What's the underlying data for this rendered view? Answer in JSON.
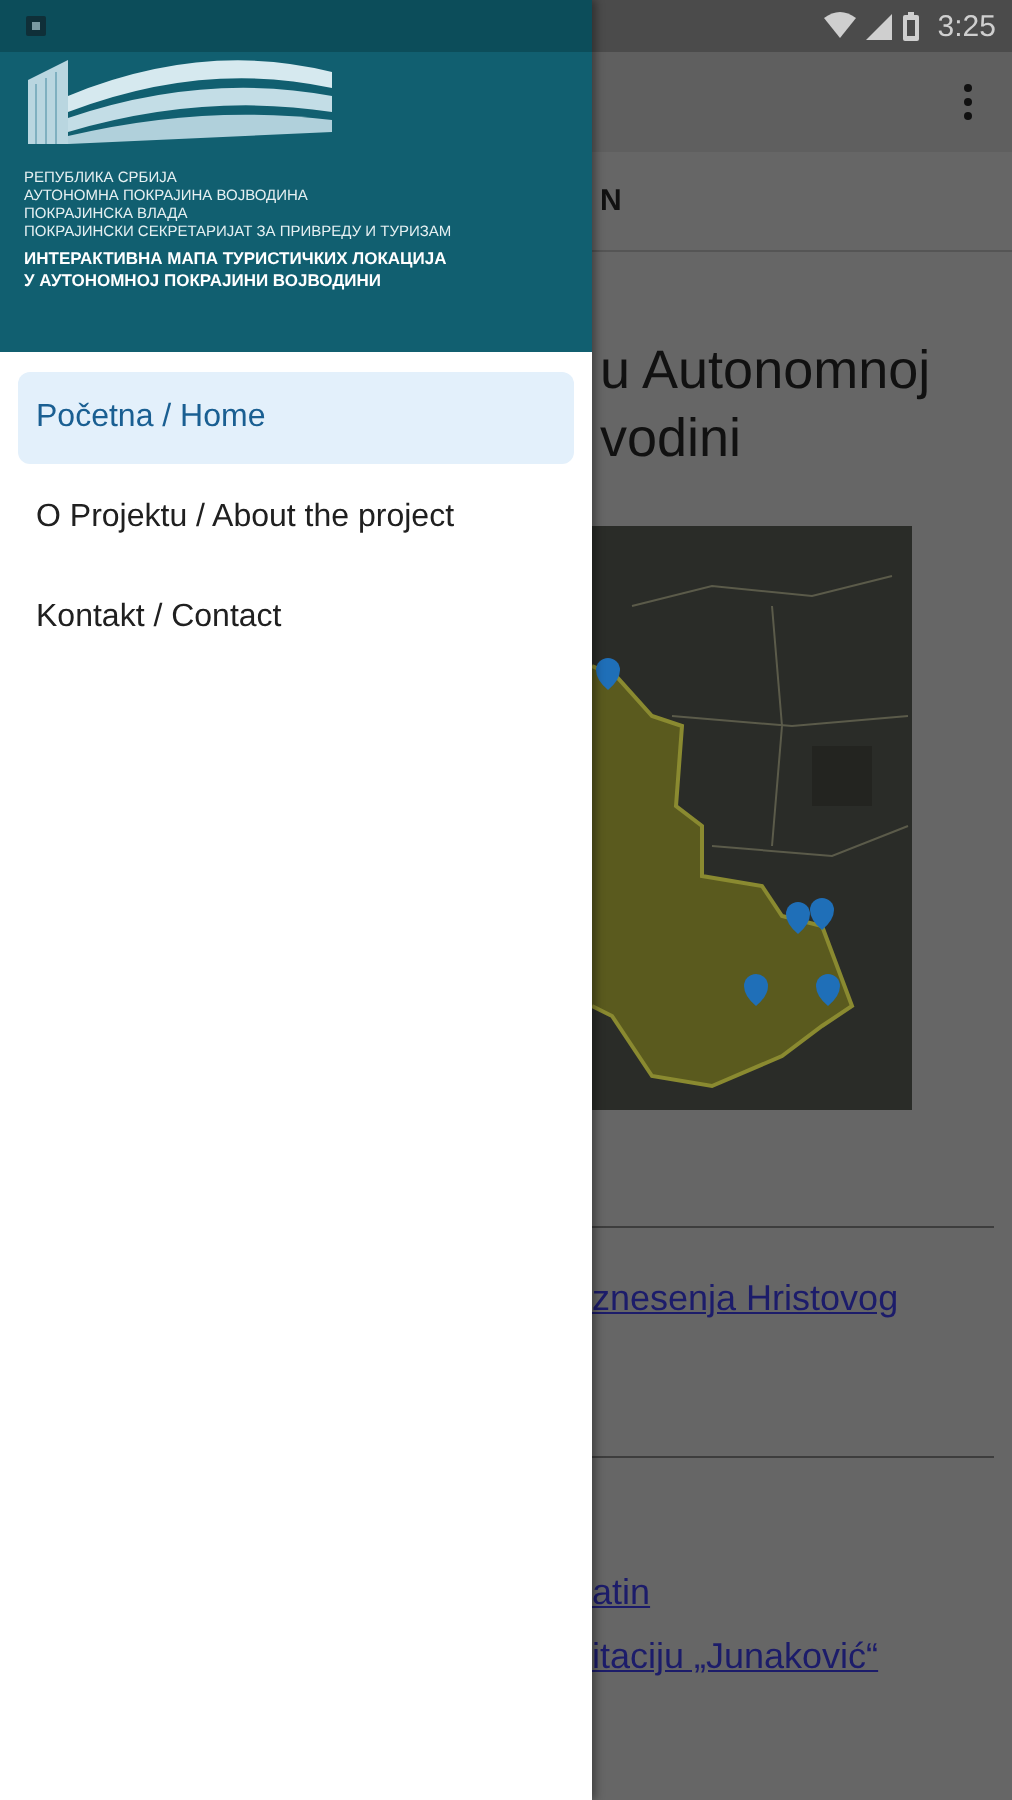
{
  "status_bar": {
    "time": "3:25"
  },
  "drawer": {
    "header": {
      "subtitle_lines": [
        "РЕПУБЛИКА СРБИЈА",
        "АУТОНОМНА ПОКРАЈИНА ВОЈВОДИНА",
        "ПОКРАЈИНСКА ВЛАДА",
        "ПОКРАЈИНСКИ СЕКРЕТАРИЈАТ ЗА ПРИВРЕДУ И ТУРИЗАМ"
      ],
      "title_lines": [
        "ИНТЕРАКТИВНА МАПА ТУРИСТИЧКИХ ЛОКАЦИЈА",
        "У АУТОНОМНОЈ ПОКРАЈИНИ ВОЈВОДИНИ"
      ]
    },
    "items": [
      {
        "label": "Početna / Home",
        "selected": true
      },
      {
        "label": "O Projektu / About the project",
        "selected": false
      },
      {
        "label": "Kontakt / Contact",
        "selected": false
      }
    ]
  },
  "background_page": {
    "tab_label": "N",
    "heading_lines": [
      "u Autonomnoj",
      "vodini"
    ],
    "map": {
      "kind": "picture"
    },
    "sections": [
      {
        "links": [
          "znesenja Hristovog"
        ]
      },
      {
        "links": [
          "atin",
          "itaciju „Junaković“"
        ]
      }
    ]
  }
}
